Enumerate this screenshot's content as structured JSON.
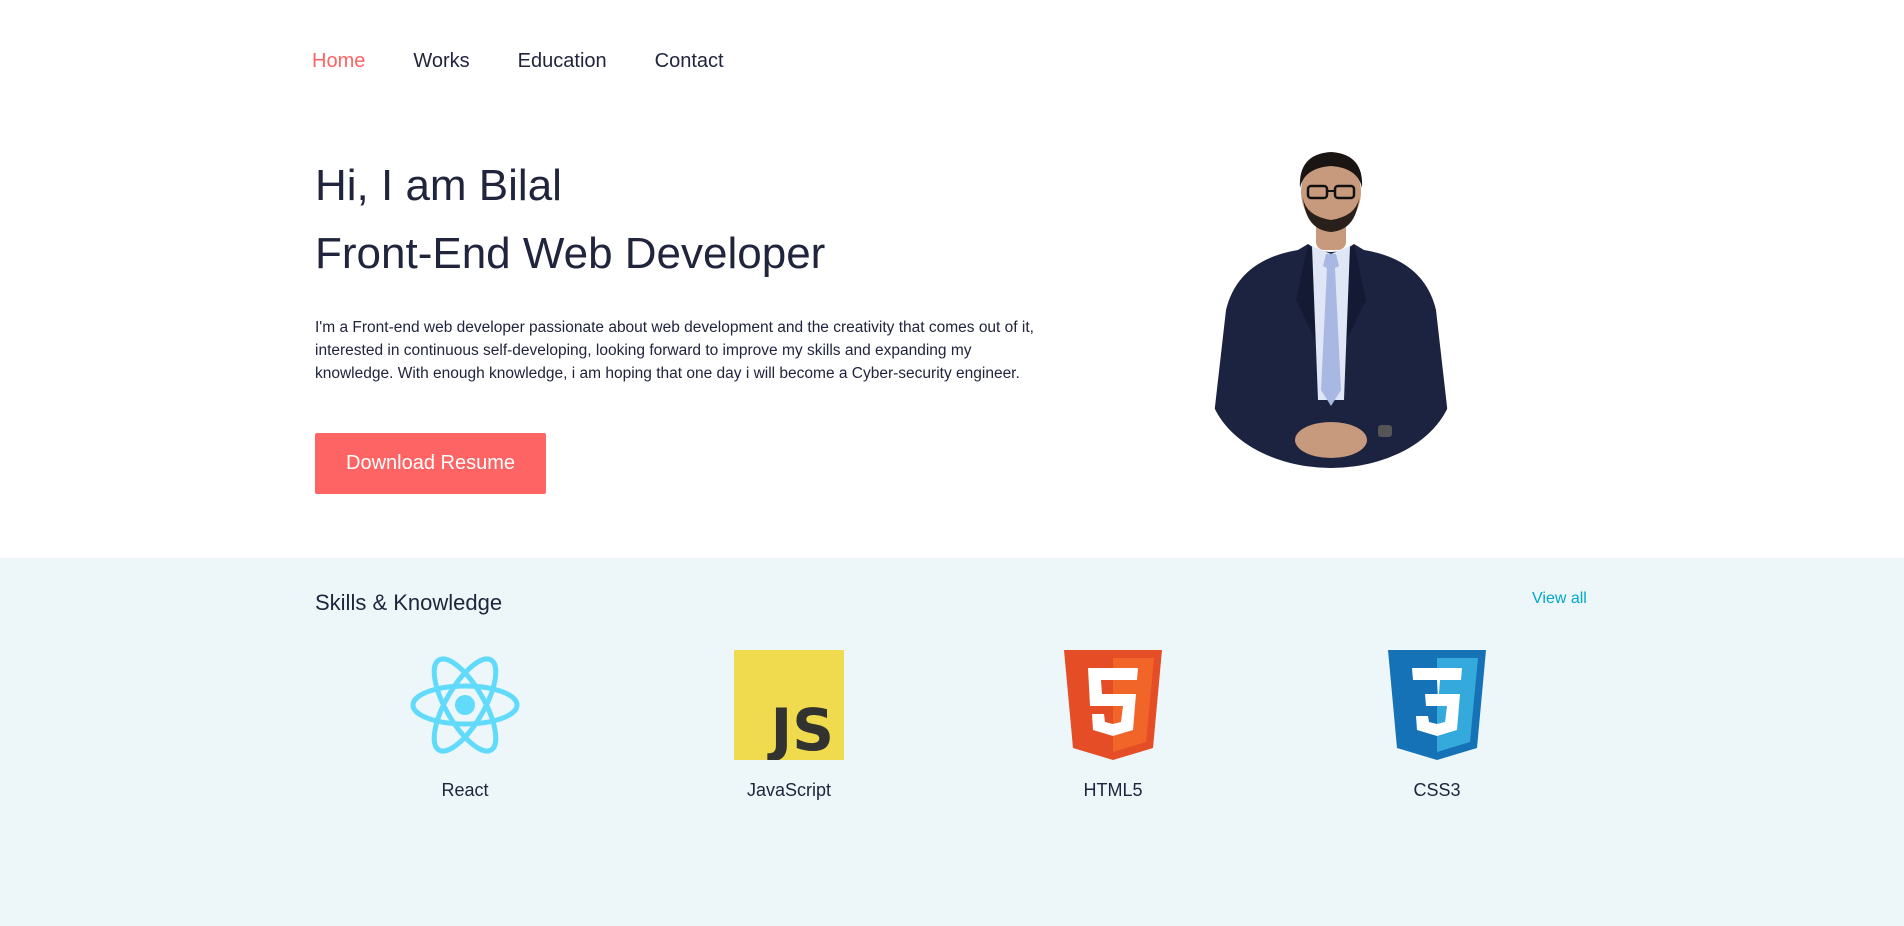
{
  "nav": {
    "items": [
      {
        "label": "Home",
        "active": true
      },
      {
        "label": "Works",
        "active": false
      },
      {
        "label": "Education",
        "active": false
      },
      {
        "label": "Contact",
        "active": false
      }
    ]
  },
  "hero": {
    "greeting": "Hi, I am Bilal",
    "role": "Front-End Web Developer",
    "description": "I'm a Front-end web developer passionate about web development and the creativity that comes out of it, interested in continuous self-developing, looking forward to improve my skills and expanding my knowledge. With enough knowledge, i am hoping that one day i will become a Cyber-security engineer.",
    "button_label": "Download Resume"
  },
  "skills": {
    "title": "Skills & Knowledge",
    "view_all": "View all",
    "items": [
      {
        "label": "React",
        "icon": "react-icon"
      },
      {
        "label": "JavaScript",
        "icon": "javascript-icon"
      },
      {
        "label": "HTML5",
        "icon": "html5-icon"
      },
      {
        "label": "CSS3",
        "icon": "css3-icon"
      }
    ]
  },
  "colors": {
    "accent": "#ff6464",
    "text": "#21243d",
    "link": "#00a8cc",
    "skills_bg": "#edf7fa"
  }
}
